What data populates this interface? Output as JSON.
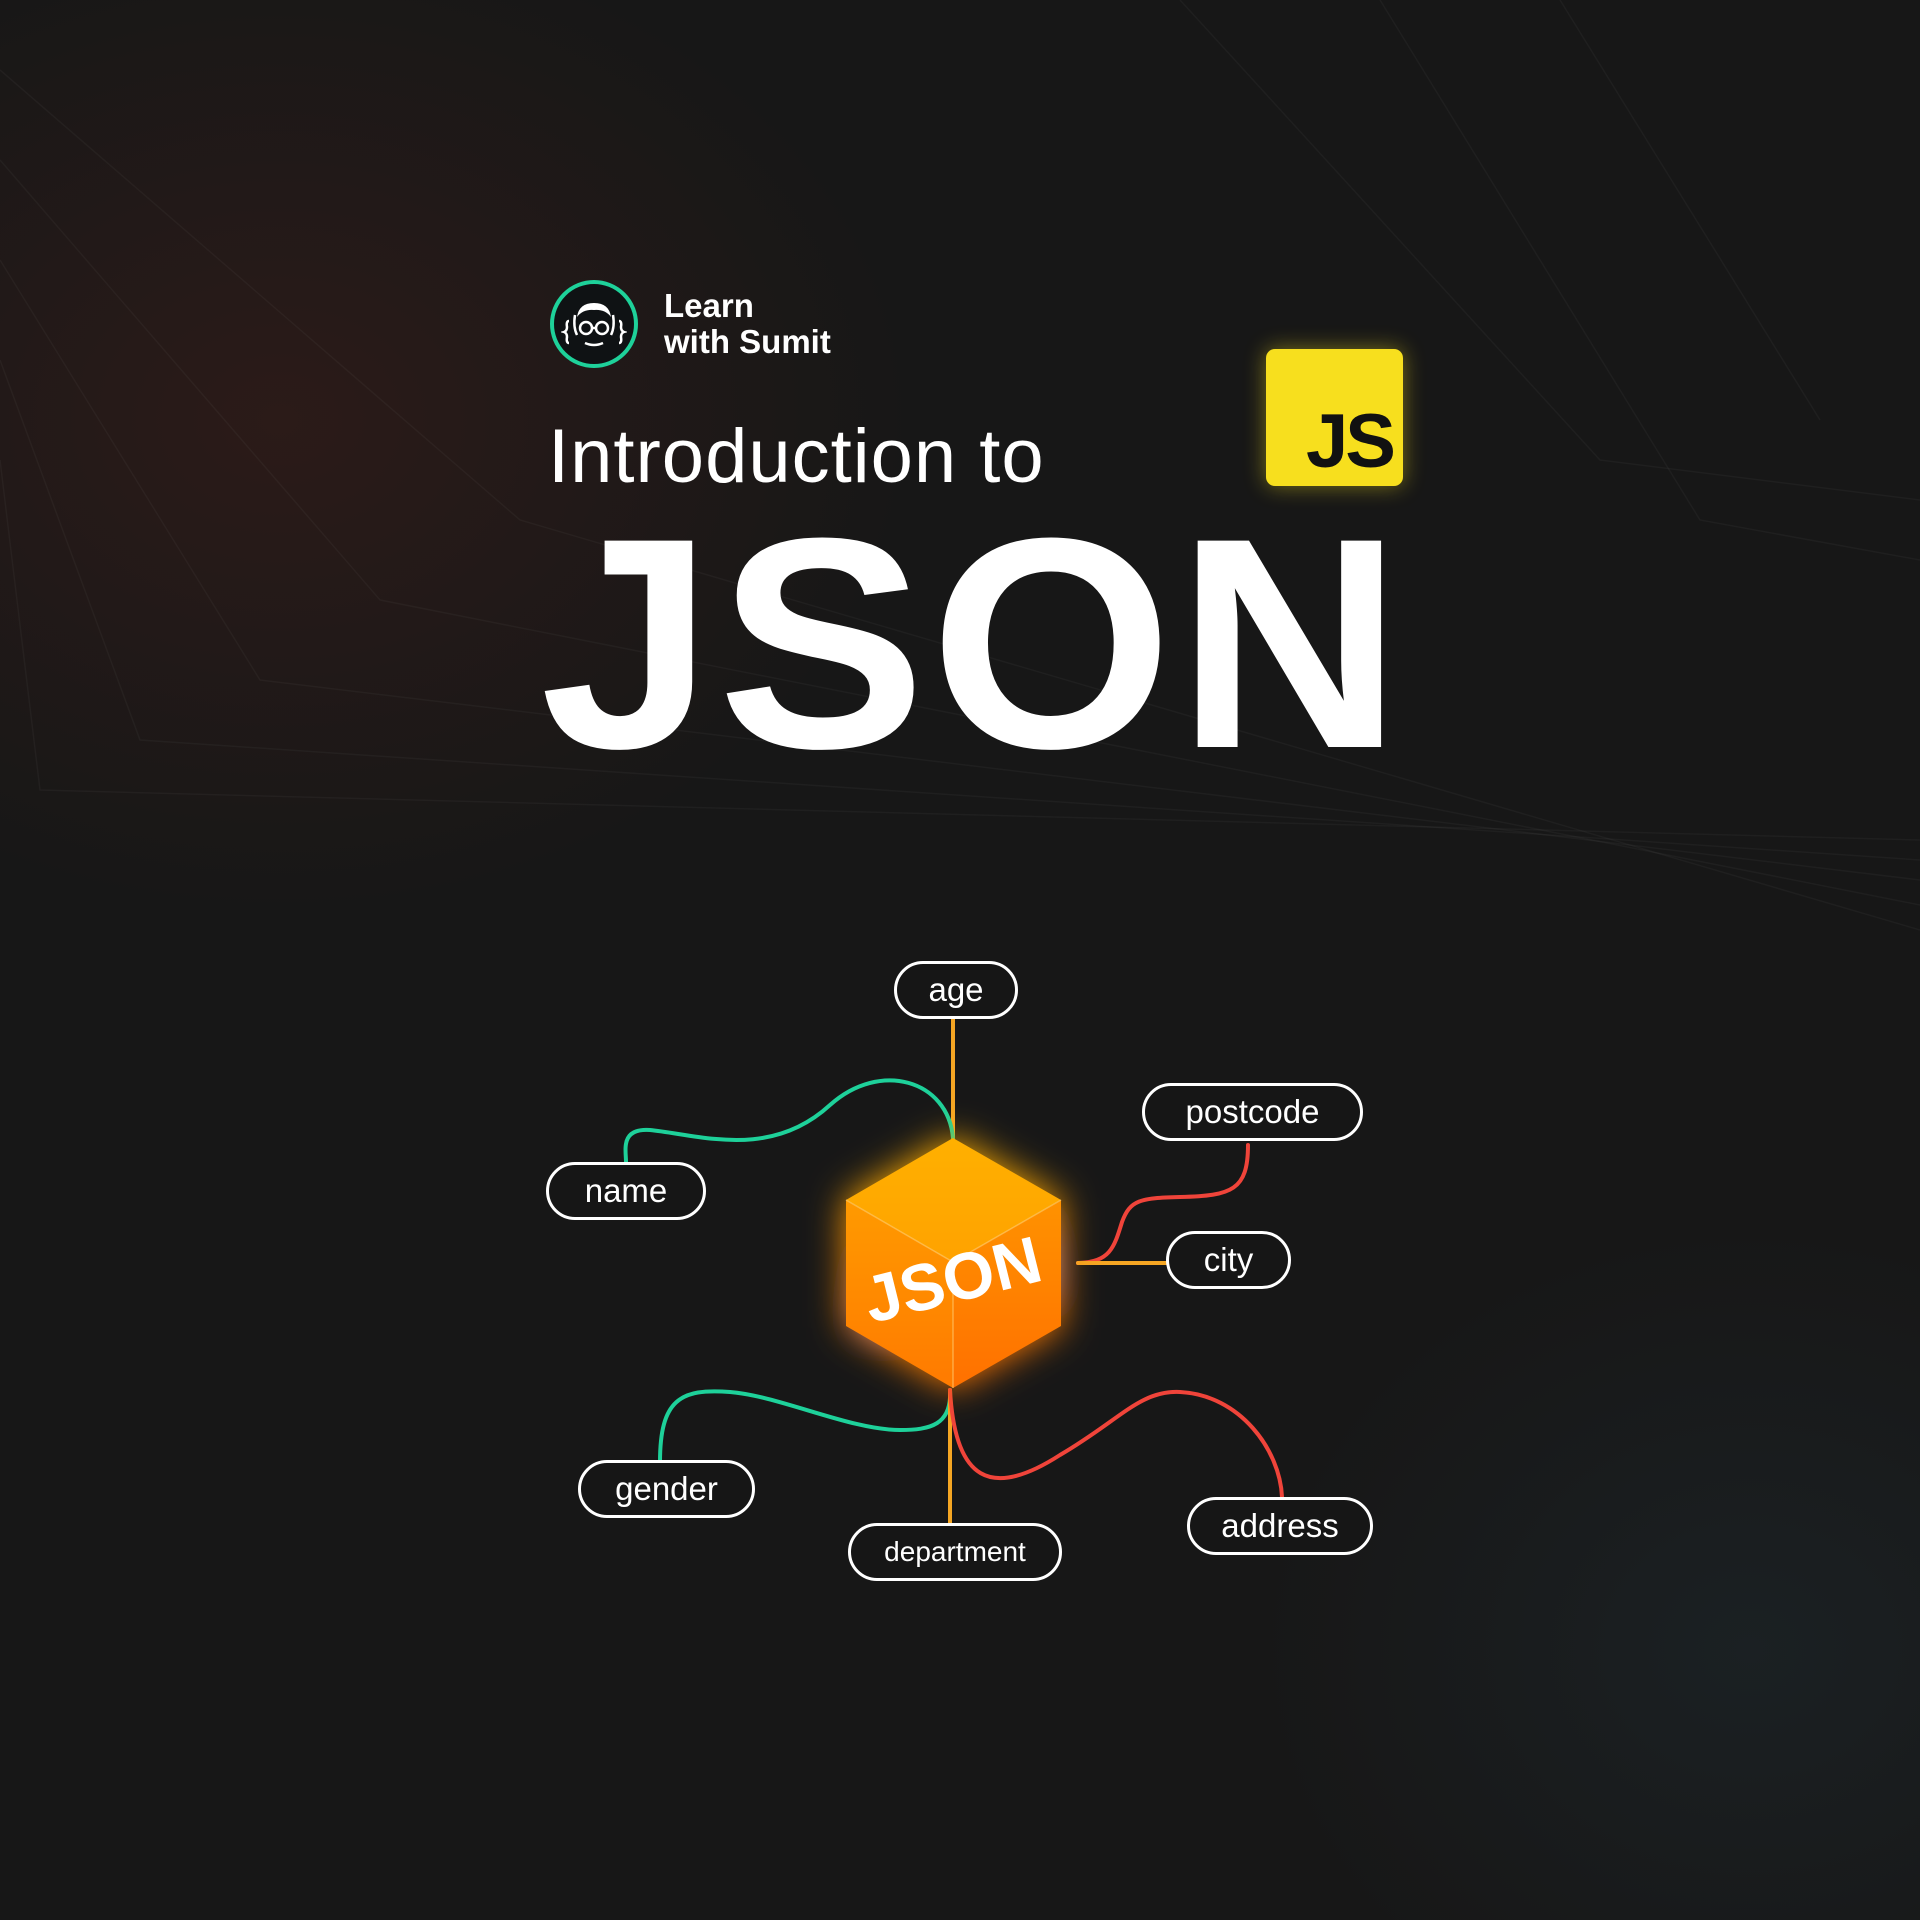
{
  "brand": {
    "line1": "Learn",
    "line2": "with Sumit",
    "logo_icon": "coder-face-icon",
    "accent": "#1ed19a"
  },
  "intro": "Introduction to",
  "title": "JSON",
  "badge": {
    "label": "JS",
    "color": "#f7df1e"
  },
  "cube": {
    "label": "JSON",
    "color": "#ff9d00"
  },
  "keys": {
    "age": "age",
    "name": "name",
    "postcode": "postcode",
    "city": "city",
    "gender": "gender",
    "department": "department",
    "address": "address"
  },
  "colors": {
    "green": "#1ed19a",
    "orange": "#f5a623",
    "red": "#f0443a",
    "background": "#171717"
  }
}
